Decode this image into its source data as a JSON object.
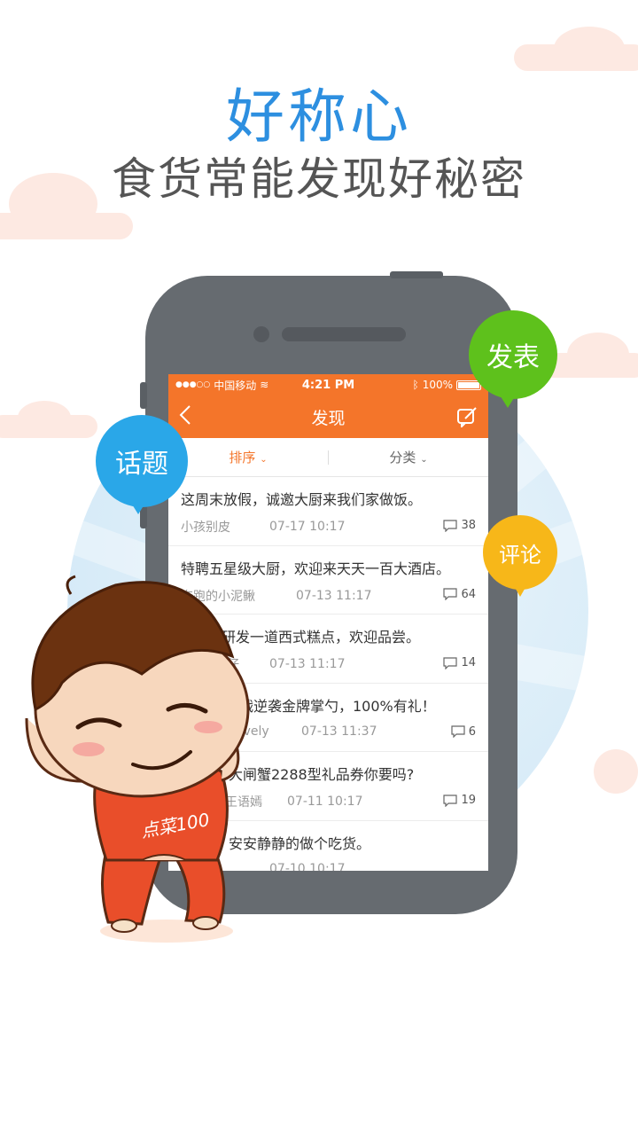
{
  "headline": {
    "main": "好称心",
    "sub": "食货常能发现好秘密"
  },
  "colors": {
    "accent_orange": "#f4752a",
    "headline_blue": "#2d8fe0",
    "bubble_blue": "#2aa7e8",
    "bubble_green": "#5ec11c",
    "bubble_yellow": "#f7b719"
  },
  "bubbles": {
    "topic": "话题",
    "publish": "发表",
    "comment": "评论"
  },
  "app": {
    "statusbar": {
      "signal": "●●●○○",
      "carrier": "中国移动",
      "time": "4:21 PM",
      "battery": "100%"
    },
    "navbar": {
      "title": "发现",
      "back_icon": "back-chevron-icon",
      "compose_icon": "compose-icon"
    },
    "filters": {
      "sort": "排序",
      "category": "分类"
    },
    "posts": [
      {
        "title": "这周末放假，诚邀大厨来我们家做饭。",
        "author": "小孩别皮",
        "date": "07-17 10:17",
        "comments": "38"
      },
      {
        "title": "特聘五星级大厨，欢迎来天天一百大酒店。",
        "author": "奔跑的小泥鳅",
        "date": "07-13 11:17",
        "comments": "64"
      },
      {
        "title": "新研发一道西式糕点，欢迎品尝。",
        "author": "仔",
        "date": "07-13 11:17",
        "comments": "14"
      },
      {
        "title": "挑战逆袭金牌掌勺，100%有礼！",
        "author": "ovely",
        "date": "07-13 11:37",
        "comments": "6"
      },
      {
        "title": "大闸蟹2288型礼品券你要吗?",
        "author": "的王语嫣",
        "date": "07-11 10:17",
        "comments": "19"
      },
      {
        "title": "安安静静的做个吃货。",
        "author": "",
        "date": "07-10 10:17",
        "comments": ""
      }
    ]
  },
  "mascot": {
    "shirt_text": "点菜100"
  }
}
